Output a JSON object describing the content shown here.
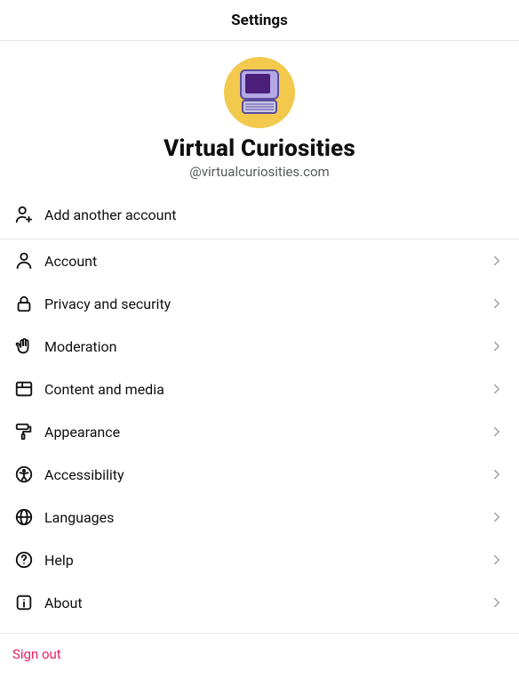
{
  "header": {
    "title": "Settings"
  },
  "profile": {
    "display_name": "Virtual Curiosities",
    "handle": "@virtualcuriosities.com"
  },
  "add_account": {
    "label": "Add another account"
  },
  "items": [
    {
      "label": "Account"
    },
    {
      "label": "Privacy and security"
    },
    {
      "label": "Moderation"
    },
    {
      "label": "Content and media"
    },
    {
      "label": "Appearance"
    },
    {
      "label": "Accessibility"
    },
    {
      "label": "Languages"
    },
    {
      "label": "Help"
    },
    {
      "label": "About"
    }
  ],
  "signout": {
    "label": "Sign out"
  }
}
